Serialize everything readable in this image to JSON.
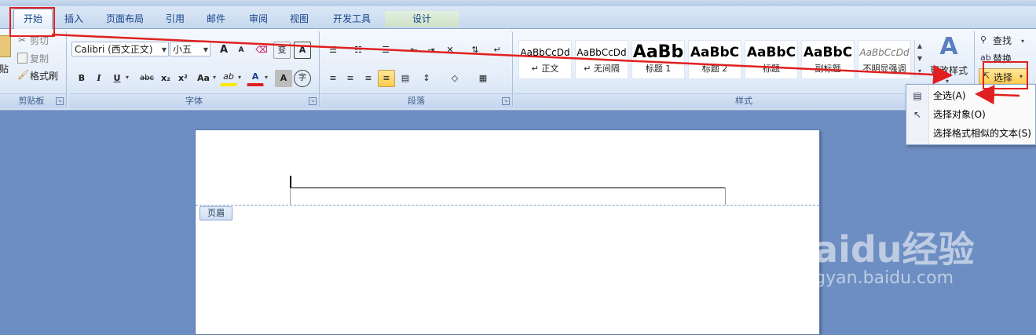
{
  "tabs": [
    "开始",
    "插入",
    "页面布局",
    "引用",
    "邮件",
    "审阅",
    "视图",
    "开发工具",
    "设计"
  ],
  "clipboard": {
    "paste_fragment": "贴",
    "cut": "剪切",
    "copy": "复制",
    "format_painter": "格式刷",
    "label": "剪贴板"
  },
  "font": {
    "name": "Calibri (西文正文)",
    "size": "小五",
    "label": "字体",
    "buttons": [
      "B",
      "I",
      "U",
      "abc",
      "x₂",
      "x²",
      "Aa",
      "ab",
      "A",
      "A",
      "字"
    ],
    "grow": "A",
    "shrink": "A",
    "phonetic": "变",
    "border_char": "A"
  },
  "paragraph": {
    "label": "段落"
  },
  "styles": {
    "label": "样式",
    "items": [
      {
        "sample": "AaBbCcDd",
        "name": "↵ 正文"
      },
      {
        "sample": "AaBbCcDd",
        "name": "↵ 无间隔"
      },
      {
        "sample": "AaBb",
        "name": "标题 1"
      },
      {
        "sample": "AaBbC",
        "name": "标题 2"
      },
      {
        "sample": "AaBbC",
        "name": "标题"
      },
      {
        "sample": "AaBbC",
        "name": "副标题"
      },
      {
        "sample": "AaBbCcDd",
        "name": "不明显强调"
      }
    ],
    "change_styles": "更改样式"
  },
  "editing": {
    "find": "查找",
    "replace": "替换",
    "select": "选择"
  },
  "select_menu": {
    "items": [
      "全选(A)",
      "选择对象(O)",
      "选择格式相似的文本(S)"
    ]
  },
  "document": {
    "header_tag": "页眉"
  },
  "watermark": {
    "brand": "Baidu经验",
    "url": "jingyan.baidu.com"
  },
  "colors": {
    "annotation_red": "#e02020",
    "highlight_yellow": "#ffe600",
    "font_red": "#e02020"
  }
}
